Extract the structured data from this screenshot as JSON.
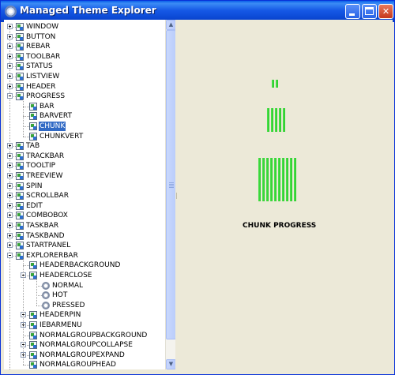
{
  "window": {
    "title": "Managed Theme Explorer",
    "icon": "theme-explorer-icon",
    "controls": {
      "minimize": "minimize",
      "maximize": "maximize",
      "close": "close"
    }
  },
  "tree": {
    "items": [
      {
        "label": "WINDOW",
        "level": 0,
        "toggle": "plus",
        "icon": "class"
      },
      {
        "label": "BUTTON",
        "level": 0,
        "toggle": "plus",
        "icon": "class"
      },
      {
        "label": "REBAR",
        "level": 0,
        "toggle": "plus",
        "icon": "class"
      },
      {
        "label": "TOOLBAR",
        "level": 0,
        "toggle": "plus",
        "icon": "class"
      },
      {
        "label": "STATUS",
        "level": 0,
        "toggle": "plus",
        "icon": "class"
      },
      {
        "label": "LISTVIEW",
        "level": 0,
        "toggle": "plus",
        "icon": "class"
      },
      {
        "label": "HEADER",
        "level": 0,
        "toggle": "plus",
        "icon": "class"
      },
      {
        "label": "PROGRESS",
        "level": 0,
        "toggle": "minus",
        "icon": "class"
      },
      {
        "label": "BAR",
        "level": 1,
        "toggle": "none",
        "icon": "part"
      },
      {
        "label": "BARVERT",
        "level": 1,
        "toggle": "none",
        "icon": "part"
      },
      {
        "label": "CHUNK",
        "level": 1,
        "toggle": "none",
        "icon": "part",
        "selected": true
      },
      {
        "label": "CHUNKVERT",
        "level": 1,
        "toggle": "none",
        "icon": "part"
      },
      {
        "label": "TAB",
        "level": 0,
        "toggle": "plus",
        "icon": "class"
      },
      {
        "label": "TRACKBAR",
        "level": 0,
        "toggle": "plus",
        "icon": "class"
      },
      {
        "label": "TOOLTIP",
        "level": 0,
        "toggle": "plus",
        "icon": "class"
      },
      {
        "label": "TREEVIEW",
        "level": 0,
        "toggle": "plus",
        "icon": "class"
      },
      {
        "label": "SPIN",
        "level": 0,
        "toggle": "plus",
        "icon": "class"
      },
      {
        "label": "SCROLLBAR",
        "level": 0,
        "toggle": "plus",
        "icon": "class"
      },
      {
        "label": "EDIT",
        "level": 0,
        "toggle": "plus",
        "icon": "class"
      },
      {
        "label": "COMBOBOX",
        "level": 0,
        "toggle": "plus",
        "icon": "class"
      },
      {
        "label": "TASKBAR",
        "level": 0,
        "toggle": "plus",
        "icon": "class"
      },
      {
        "label": "TASKBAND",
        "level": 0,
        "toggle": "plus",
        "icon": "class"
      },
      {
        "label": "STARTPANEL",
        "level": 0,
        "toggle": "plus",
        "icon": "class"
      },
      {
        "label": "EXPLORERBAR",
        "level": 0,
        "toggle": "minus",
        "icon": "class"
      },
      {
        "label": "HEADERBACKGROUND",
        "level": 1,
        "toggle": "none",
        "icon": "part"
      },
      {
        "label": "HEADERCLOSE",
        "level": 1,
        "toggle": "minus",
        "icon": "part"
      },
      {
        "label": "NORMAL",
        "level": 2,
        "toggle": "none",
        "icon": "state"
      },
      {
        "label": "HOT",
        "level": 2,
        "toggle": "none",
        "icon": "state"
      },
      {
        "label": "PRESSED",
        "level": 2,
        "toggle": "none",
        "icon": "state"
      },
      {
        "label": "HEADERPIN",
        "level": 1,
        "toggle": "plus",
        "icon": "part"
      },
      {
        "label": "IEBARMENU",
        "level": 1,
        "toggle": "plus",
        "icon": "part"
      },
      {
        "label": "NORMALGROUPBACKGROUND",
        "level": 1,
        "toggle": "none",
        "icon": "part"
      },
      {
        "label": "NORMALGROUPCOLLAPSE",
        "level": 1,
        "toggle": "plus",
        "icon": "part"
      },
      {
        "label": "NORMALGROUPEXPAND",
        "level": 1,
        "toggle": "plus",
        "icon": "part"
      },
      {
        "label": "NORMALGROUPHEAD",
        "level": 1,
        "toggle": "none",
        "icon": "part"
      }
    ]
  },
  "preview": {
    "label": "CHUNK PROGRESS",
    "chunk_color": "#33cc33",
    "samples": [
      {
        "chunks": 2
      },
      {
        "chunks": 5
      },
      {
        "chunks": 10
      }
    ]
  },
  "colors": {
    "titlebar": "#0a4fdc",
    "selection": "#316ac5",
    "preview_background": "#ece9d8"
  }
}
